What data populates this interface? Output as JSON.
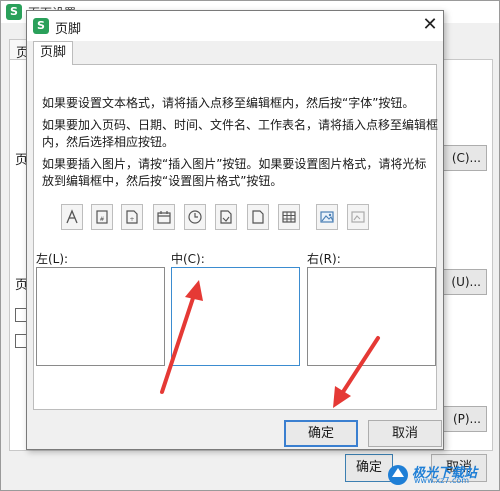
{
  "background_dialog": {
    "title": "页面设置",
    "tab": "页",
    "side_labels": [
      "页",
      "页"
    ],
    "right_buttons": [
      "(C)...",
      "(U)...",
      "(P)..."
    ],
    "ok": "确定",
    "cancel": "取消"
  },
  "dialog": {
    "title": "页脚",
    "tab": "页脚",
    "instructions": [
      "如果要设置文本格式，请将插入点移至编辑框内，然后按“字体”按钮。",
      "如果要加入页码、日期、时间、文件名、工作表名，请将插入点移至编辑框内，然后选择相应按钮。",
      "如果要插入图片，请按“插入图片”按钮。如果要设置图片格式，请将光标放到编辑框中，然后按“设置图片格式”按钮。"
    ],
    "toolbar_icons": [
      "font-icon",
      "page-number-icon",
      "total-pages-icon",
      "date-icon",
      "time-icon",
      "file-path-icon",
      "file-name-icon",
      "sheet-name-icon",
      "insert-picture-icon",
      "format-picture-icon"
    ],
    "sections": {
      "left": "左(L):",
      "center": "中(C):",
      "right": "右(R):"
    },
    "ok": "确定",
    "cancel": "取消"
  },
  "annotations": {
    "arrow_color": "#e53935"
  },
  "watermark": {
    "text": "极光下载站",
    "url": "www.xz7.com"
  }
}
